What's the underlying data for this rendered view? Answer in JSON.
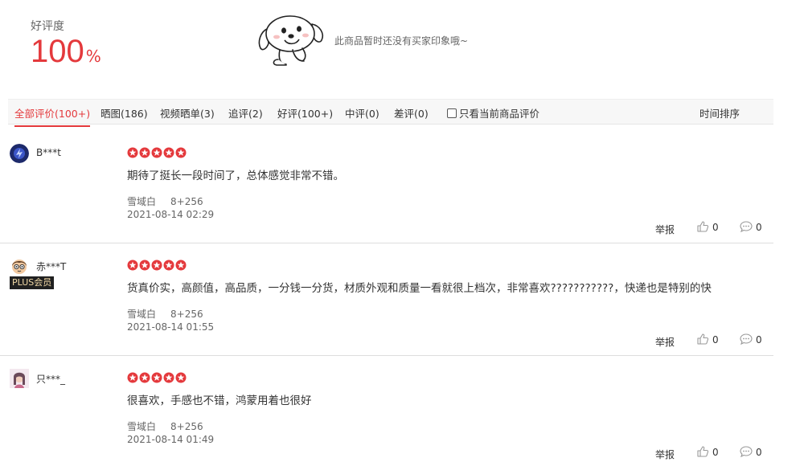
{
  "summary": {
    "rate_label": "好评度",
    "rate_value": "100",
    "rate_unit": "%",
    "notice": "此商品暂时还没有买家印象哦~",
    "mascot_icon": "jd-dog-mascot-icon"
  },
  "filters": {
    "all": "全部评价(100+)",
    "photos": "晒图(186)",
    "video": "视频晒单(3)",
    "followup": "追评(2)",
    "good": "好评(100+)",
    "medium": "中评(0)",
    "bad": "差评(0)",
    "current_only": "只看当前商品评价",
    "sort": "时间排序"
  },
  "reviews": [
    {
      "username": "B***t",
      "badge": "",
      "rating": 5,
      "content": "期待了挺长一段时间了，总体感觉非常不错。",
      "color": "雪域白",
      "spec": "8+256",
      "date": "2021-08-14 02:29",
      "report": "举报",
      "likes": "0",
      "replies": "0"
    },
    {
      "username": "赤***T",
      "badge": "PLUS会员",
      "rating": 5,
      "content": "货真价实，高颜值，高品质，一分钱一分货，材质外观和质量一看就很上档次，非常喜欢???????????，快递也是特别的快",
      "color": "雪域白",
      "spec": "8+256",
      "date": "2021-08-14 01:55",
      "report": "举报",
      "likes": "0",
      "replies": "0"
    },
    {
      "username": "只***_",
      "badge": "",
      "rating": 5,
      "content": "很喜欢，手感也不错，鸿蒙用着也很好",
      "color": "雪域白",
      "spec": "8+256",
      "date": "2021-08-14 01:49",
      "report": "举报",
      "likes": "0",
      "replies": "0"
    }
  ],
  "colors": {
    "accent": "#e4393c",
    "star": "#e4393c"
  }
}
